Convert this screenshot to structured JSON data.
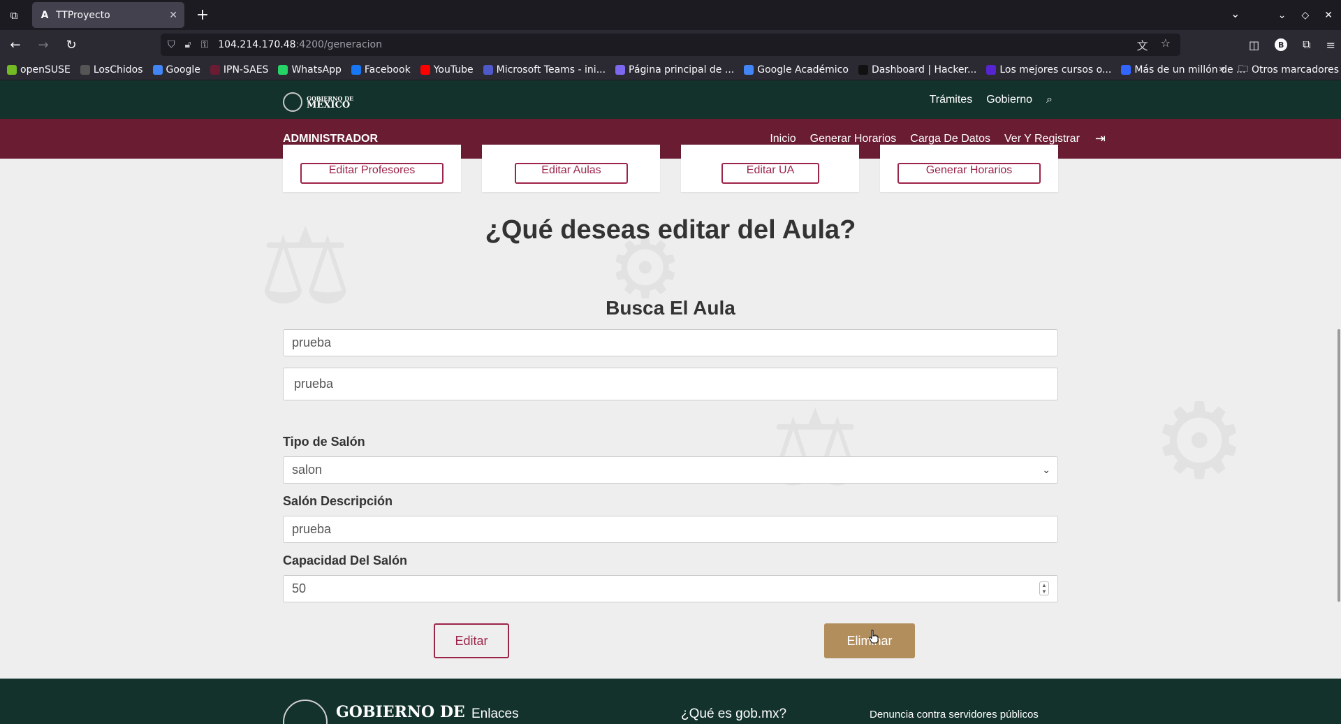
{
  "browser": {
    "tab_title": "TTProyecto",
    "tab_favicon": "A",
    "url_host": "104.214.170.48",
    "url_path": ":4200/generacion",
    "bookmarks": [
      {
        "label": "openSUSE",
        "color": "#73ba25"
      },
      {
        "label": "LosChidos",
        "color": "#555555"
      },
      {
        "label": "Google",
        "color": "#4285f4"
      },
      {
        "label": "IPN-SAES",
        "color": "#691c32"
      },
      {
        "label": "WhatsApp",
        "color": "#25d366"
      },
      {
        "label": "Facebook",
        "color": "#1877f2"
      },
      {
        "label": "YouTube",
        "color": "#ff0000"
      },
      {
        "label": "Microsoft Teams - ini...",
        "color": "#5059c9"
      },
      {
        "label": "Página principal de ...",
        "color": "#7b68ee"
      },
      {
        "label": "Google Académico",
        "color": "#4285f4"
      },
      {
        "label": "Dashboard | Hacker...",
        "color": "#111111"
      },
      {
        "label": "Los mejores cursos o...",
        "color": "#5624d0"
      },
      {
        "label": "Más de un millón de ...",
        "color": "#3366ff"
      }
    ],
    "other_bookmarks": "Otros marcadores"
  },
  "gob_header": {
    "logo_small": "GOBIERNO DE",
    "logo_big": "MÉXICO",
    "links": [
      "Trámites",
      "Gobierno"
    ]
  },
  "admin_bar": {
    "title": "ADMINISTRADOR",
    "menu": [
      "Inicio",
      "Generar Horarios",
      "Carga De Datos",
      "Ver Y Registrar"
    ]
  },
  "cards": [
    "Editar Profesores",
    "Editar Aulas",
    "Editar UA",
    "Generar Horarios"
  ],
  "main": {
    "title": "¿Qué deseas editar del Aula?",
    "search_title": "Busca El Aula",
    "search_value": "prueba",
    "selected_aula": "prueba",
    "tipo_label": "Tipo de Salón",
    "tipo_value": "salon",
    "desc_label": "Salón Descripción",
    "desc_value": "prueba",
    "cap_label": "Capacidad Del Salón",
    "cap_value": "50",
    "edit_button": "Editar",
    "delete_button": "Eliminar"
  },
  "footer": {
    "logo_text": "GOBIERNO DE",
    "col1": "Enlaces",
    "col2": "¿Qué es gob.mx?",
    "col3": "Denuncia contra servidores públicos"
  },
  "colors": {
    "gob_green": "#13322b",
    "guinda": "#691c32",
    "accent_red": "#9d2449",
    "gold": "#b38e5d"
  }
}
